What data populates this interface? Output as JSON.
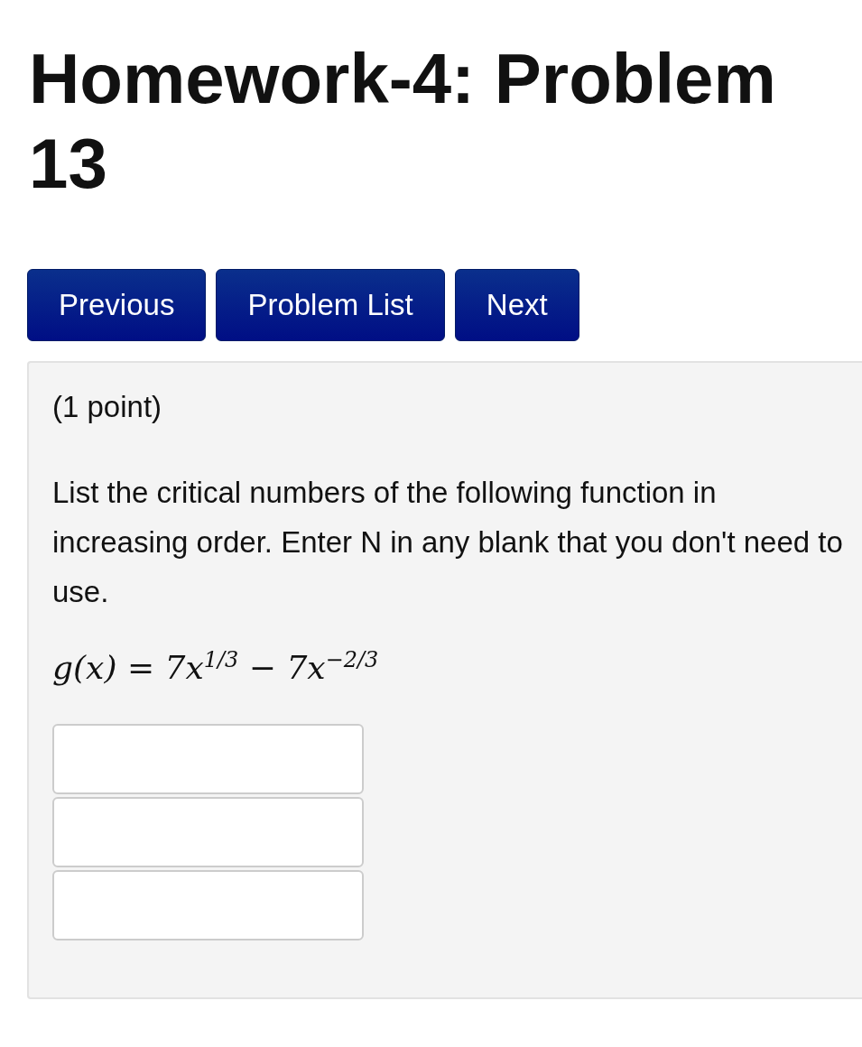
{
  "title": "Homework-4: Problem 13",
  "nav_buttons": [
    "Previous",
    "Problem List",
    "Next"
  ],
  "problem": {
    "points": "(1 point)",
    "statement": "List the critical numbers of the following function in increasing order. Enter N in any blank that you don't need to use.",
    "formula": "g(x) = 7x$^{1/3}$ − 7x$^{−2/3}$",
    "answer_fields": [
      {
        "kind": "text"
      },
      {
        "kind": "text"
      },
      {
        "kind": "text"
      }
    ]
  }
}
